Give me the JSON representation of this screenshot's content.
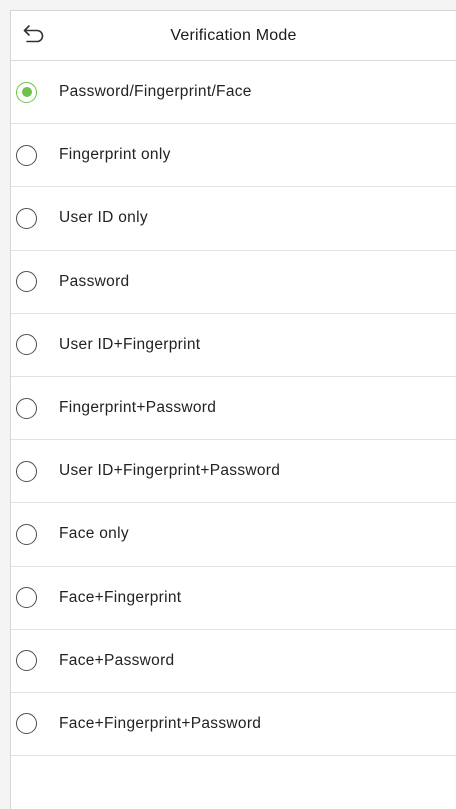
{
  "header": {
    "title": "Verification Mode",
    "back_icon": "back-arrow-icon"
  },
  "colors": {
    "accent": "#6cc24a",
    "radio_border": "#4d4d4d",
    "divider": "#e2e2e2"
  },
  "options": [
    {
      "label": "Password/Fingerprint/Face",
      "selected": true
    },
    {
      "label": "Fingerprint only",
      "selected": false
    },
    {
      "label": "User ID only",
      "selected": false
    },
    {
      "label": "Password",
      "selected": false
    },
    {
      "label": "User ID+Fingerprint",
      "selected": false
    },
    {
      "label": "Fingerprint+Password",
      "selected": false
    },
    {
      "label": "User ID+Fingerprint+Password",
      "selected": false
    },
    {
      "label": "Face only",
      "selected": false
    },
    {
      "label": "Face+Fingerprint",
      "selected": false
    },
    {
      "label": "Face+Password",
      "selected": false
    },
    {
      "label": "Face+Fingerprint+Password",
      "selected": false
    }
  ]
}
